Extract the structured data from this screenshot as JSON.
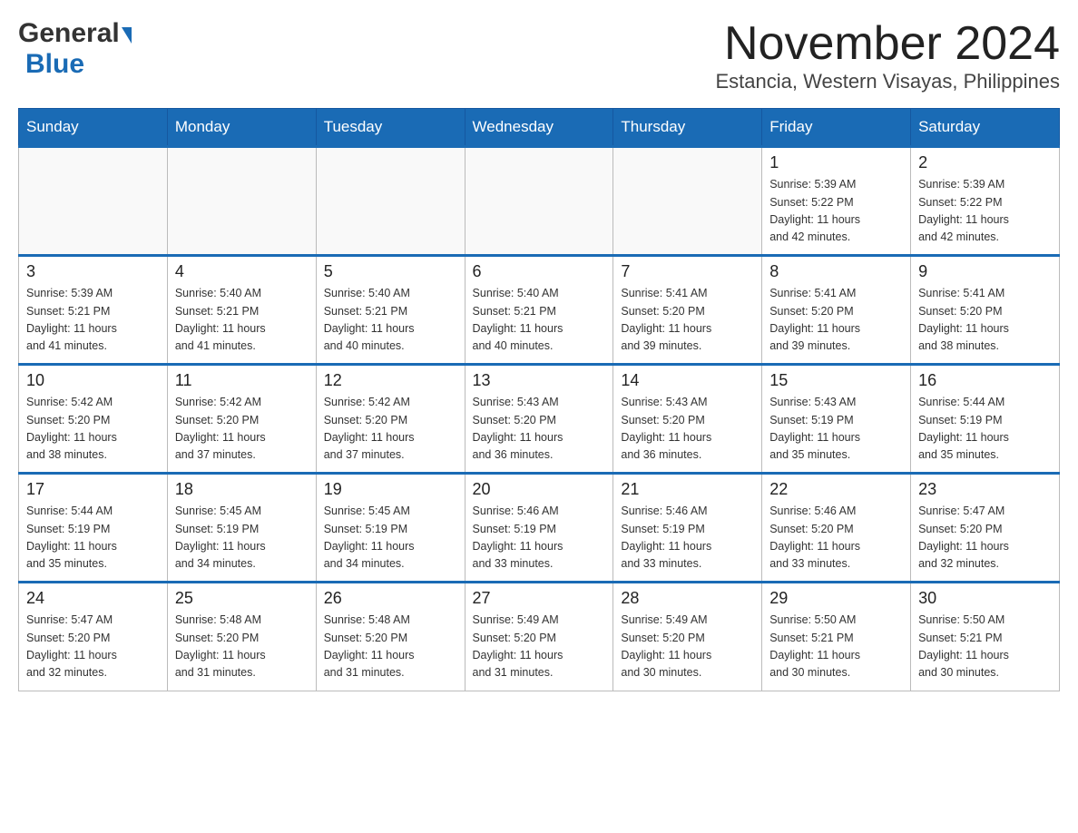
{
  "header": {
    "logo_general": "General",
    "logo_blue": "Blue",
    "title": "November 2024",
    "subtitle": "Estancia, Western Visayas, Philippines"
  },
  "days_of_week": [
    "Sunday",
    "Monday",
    "Tuesday",
    "Wednesday",
    "Thursday",
    "Friday",
    "Saturday"
  ],
  "weeks": [
    {
      "days": [
        {
          "date": "",
          "info": ""
        },
        {
          "date": "",
          "info": ""
        },
        {
          "date": "",
          "info": ""
        },
        {
          "date": "",
          "info": ""
        },
        {
          "date": "",
          "info": ""
        },
        {
          "date": "1",
          "info": "Sunrise: 5:39 AM\nSunset: 5:22 PM\nDaylight: 11 hours\nand 42 minutes."
        },
        {
          "date": "2",
          "info": "Sunrise: 5:39 AM\nSunset: 5:22 PM\nDaylight: 11 hours\nand 42 minutes."
        }
      ]
    },
    {
      "days": [
        {
          "date": "3",
          "info": "Sunrise: 5:39 AM\nSunset: 5:21 PM\nDaylight: 11 hours\nand 41 minutes."
        },
        {
          "date": "4",
          "info": "Sunrise: 5:40 AM\nSunset: 5:21 PM\nDaylight: 11 hours\nand 41 minutes."
        },
        {
          "date": "5",
          "info": "Sunrise: 5:40 AM\nSunset: 5:21 PM\nDaylight: 11 hours\nand 40 minutes."
        },
        {
          "date": "6",
          "info": "Sunrise: 5:40 AM\nSunset: 5:21 PM\nDaylight: 11 hours\nand 40 minutes."
        },
        {
          "date": "7",
          "info": "Sunrise: 5:41 AM\nSunset: 5:20 PM\nDaylight: 11 hours\nand 39 minutes."
        },
        {
          "date": "8",
          "info": "Sunrise: 5:41 AM\nSunset: 5:20 PM\nDaylight: 11 hours\nand 39 minutes."
        },
        {
          "date": "9",
          "info": "Sunrise: 5:41 AM\nSunset: 5:20 PM\nDaylight: 11 hours\nand 38 minutes."
        }
      ]
    },
    {
      "days": [
        {
          "date": "10",
          "info": "Sunrise: 5:42 AM\nSunset: 5:20 PM\nDaylight: 11 hours\nand 38 minutes."
        },
        {
          "date": "11",
          "info": "Sunrise: 5:42 AM\nSunset: 5:20 PM\nDaylight: 11 hours\nand 37 minutes."
        },
        {
          "date": "12",
          "info": "Sunrise: 5:42 AM\nSunset: 5:20 PM\nDaylight: 11 hours\nand 37 minutes."
        },
        {
          "date": "13",
          "info": "Sunrise: 5:43 AM\nSunset: 5:20 PM\nDaylight: 11 hours\nand 36 minutes."
        },
        {
          "date": "14",
          "info": "Sunrise: 5:43 AM\nSunset: 5:20 PM\nDaylight: 11 hours\nand 36 minutes."
        },
        {
          "date": "15",
          "info": "Sunrise: 5:43 AM\nSunset: 5:19 PM\nDaylight: 11 hours\nand 35 minutes."
        },
        {
          "date": "16",
          "info": "Sunrise: 5:44 AM\nSunset: 5:19 PM\nDaylight: 11 hours\nand 35 minutes."
        }
      ]
    },
    {
      "days": [
        {
          "date": "17",
          "info": "Sunrise: 5:44 AM\nSunset: 5:19 PM\nDaylight: 11 hours\nand 35 minutes."
        },
        {
          "date": "18",
          "info": "Sunrise: 5:45 AM\nSunset: 5:19 PM\nDaylight: 11 hours\nand 34 minutes."
        },
        {
          "date": "19",
          "info": "Sunrise: 5:45 AM\nSunset: 5:19 PM\nDaylight: 11 hours\nand 34 minutes."
        },
        {
          "date": "20",
          "info": "Sunrise: 5:46 AM\nSunset: 5:19 PM\nDaylight: 11 hours\nand 33 minutes."
        },
        {
          "date": "21",
          "info": "Sunrise: 5:46 AM\nSunset: 5:19 PM\nDaylight: 11 hours\nand 33 minutes."
        },
        {
          "date": "22",
          "info": "Sunrise: 5:46 AM\nSunset: 5:20 PM\nDaylight: 11 hours\nand 33 minutes."
        },
        {
          "date": "23",
          "info": "Sunrise: 5:47 AM\nSunset: 5:20 PM\nDaylight: 11 hours\nand 32 minutes."
        }
      ]
    },
    {
      "days": [
        {
          "date": "24",
          "info": "Sunrise: 5:47 AM\nSunset: 5:20 PM\nDaylight: 11 hours\nand 32 minutes."
        },
        {
          "date": "25",
          "info": "Sunrise: 5:48 AM\nSunset: 5:20 PM\nDaylight: 11 hours\nand 31 minutes."
        },
        {
          "date": "26",
          "info": "Sunrise: 5:48 AM\nSunset: 5:20 PM\nDaylight: 11 hours\nand 31 minutes."
        },
        {
          "date": "27",
          "info": "Sunrise: 5:49 AM\nSunset: 5:20 PM\nDaylight: 11 hours\nand 31 minutes."
        },
        {
          "date": "28",
          "info": "Sunrise: 5:49 AM\nSunset: 5:20 PM\nDaylight: 11 hours\nand 30 minutes."
        },
        {
          "date": "29",
          "info": "Sunrise: 5:50 AM\nSunset: 5:21 PM\nDaylight: 11 hours\nand 30 minutes."
        },
        {
          "date": "30",
          "info": "Sunrise: 5:50 AM\nSunset: 5:21 PM\nDaylight: 11 hours\nand 30 minutes."
        }
      ]
    }
  ]
}
